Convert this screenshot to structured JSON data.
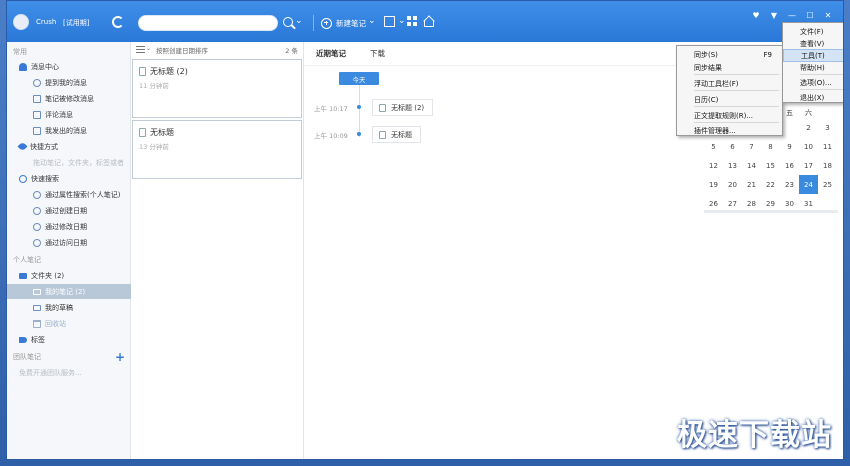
{
  "titlebar": {
    "username": "Crush",
    "trial": "[试用期]",
    "search_placeholder": "",
    "new_note": "新建笔记"
  },
  "sidebar": {
    "common": "常用",
    "messages": "消息中心",
    "mentions": "提到我的消息",
    "modified": "笔记被修改消息",
    "comments": "评论消息",
    "sent": "我发出的消息",
    "shortcuts": "快捷方式",
    "shortcuts_hint": "拖动笔记，文件夹，标签或者",
    "quick_search": "快速搜索",
    "by_attr": "通过属性搜索(个人笔记)",
    "by_created": "通过创建日期",
    "by_modified": "通过修改日期",
    "by_visited": "通过访问日期",
    "personal": "个人笔记",
    "folders": "文件夹 (2)",
    "my_notes": "我的笔记 (2)",
    "drafts": "我的草稿",
    "recycle": "回收站",
    "tags": "标签",
    "team": "团队笔记",
    "team_hint": "免费开通团队服务..."
  },
  "notelist": {
    "sort": "按照创建日期排序",
    "count": "2 条",
    "notes": [
      {
        "title": "无标题 (2)",
        "ago": "11 分钟前"
      },
      {
        "title": "无标题",
        "ago": "13 分钟前"
      }
    ]
  },
  "main": {
    "tab_recent": "近期笔记",
    "tab_download": "下载",
    "today": "今天",
    "timeline": [
      {
        "time": "上午 10:17",
        "title": "无标题 (2)"
      },
      {
        "time": "上午 10:09",
        "title": "无标题"
      }
    ]
  },
  "calendar": {
    "weekdays": [
      "",
      "",
      "",
      "",
      "五",
      "六",
      ""
    ],
    "weeks": [
      [
        "",
        "",
        "",
        "",
        "",
        "2",
        "3"
      ],
      [
        "5",
        "6",
        "7",
        "8",
        "9",
        "10",
        "11"
      ],
      [
        "12",
        "13",
        "14",
        "15",
        "16",
        "17",
        "18"
      ],
      [
        "19",
        "20",
        "21",
        "22",
        "23",
        "24",
        "25"
      ],
      [
        "26",
        "27",
        "28",
        "29",
        "30",
        "31",
        ""
      ]
    ],
    "today": "24"
  },
  "main_menu": {
    "items": [
      "文件(F)",
      "查看(V)",
      "工具(T)",
      "帮助(H)",
      "选项(O)...",
      "退出(X)"
    ]
  },
  "tools_menu": {
    "items": [
      {
        "label": "同步(S)",
        "shortcut": "F9"
      },
      {
        "label": "同步结果",
        "shortcut": ""
      },
      {
        "label": "浮动工具栏(F)",
        "shortcut": ""
      },
      {
        "label": "日历(C)",
        "shortcut": ""
      },
      {
        "label": "正文提取规则(R)...",
        "shortcut": ""
      },
      {
        "label": "插件管理器...",
        "shortcut": ""
      }
    ]
  },
  "watermark": "极速下载站",
  "colors": {
    "titlebar": "#2a78d8",
    "accent": "#3a8ae0",
    "selected": "#b9c8d9"
  }
}
